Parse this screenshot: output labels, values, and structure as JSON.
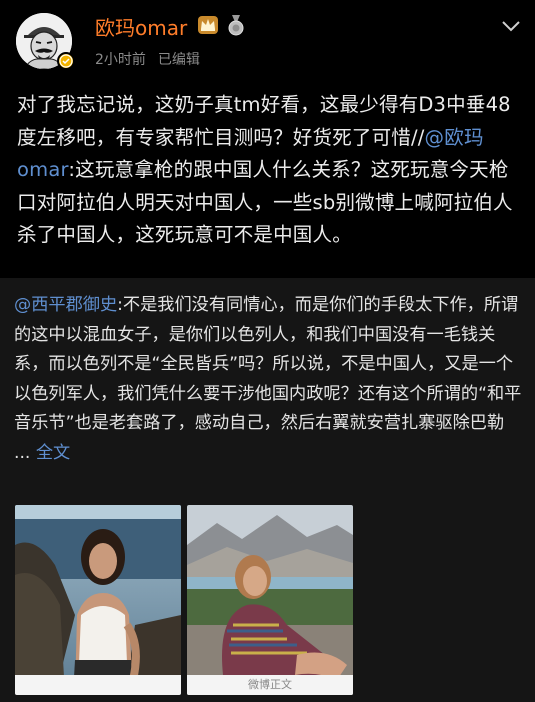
{
  "post": {
    "author": "欧玛omar",
    "time": "2小时前",
    "edited": "已编辑",
    "text_before_mention": "对了我忘记说，这奶子真tm好看，这最少得有D3中垂48度左移吧，有专家帮忙目测吗？好货死了可惜//",
    "mention": "@欧玛omar",
    "text_after_mention": ":这玩意拿枪的跟中国人什么关系？这死玩意今天枪口对阿拉伯人明天对中国人，一些sb别微博上喊阿拉伯人杀了中国人，这死玩意可不是中国人。"
  },
  "retweet": {
    "author": "@西平郡御史",
    "text": ":不是我们没有同情心，而是你们的手段太下作，所谓的这中以混血女子，是你们以色列人，和我们中国没有一毛钱关系，而以色列不是“全民皆兵”吗？所以说，不是中国人，又是一个以色列军人，我们凭什么要干涉他国内政呢？还有这个所谓的“和平音乐节”也是老套路了，感动自己，然后右翼就安营扎寨驱除巴勒 ...",
    "full_text_link": "全文",
    "image2_caption": "微博正文"
  },
  "icons": {
    "avatar": "avatar-portrait",
    "verified": "verified-badge-icon",
    "crown": "crown-badge-icon",
    "medal": "medal-badge-icon",
    "more": "chevron-down-icon"
  },
  "colors": {
    "username": "#ff7d2a",
    "mention": "#5f8fd0",
    "background": "#000000",
    "retweet_bg": "#151515",
    "meta": "#8a8a8a"
  }
}
